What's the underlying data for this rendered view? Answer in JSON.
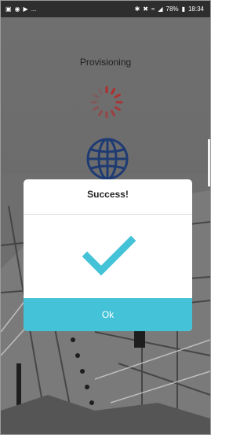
{
  "status_bar": {
    "left_icons": [
      "notification-icon",
      "shield-icon",
      "play-icon"
    ],
    "left_more": "...",
    "right_icons": [
      "bluetooth-icon",
      "mute-icon",
      "wifi-icon",
      "signal-icon"
    ],
    "battery_percent": "78%",
    "time": "18:34"
  },
  "screen": {
    "title": "Provisioning"
  },
  "dialog": {
    "title": "Success!",
    "ok_label": "Ok"
  },
  "colors": {
    "accent": "#44c2d7",
    "globe": "#1f3b73",
    "spinner": "#b32c2c"
  }
}
